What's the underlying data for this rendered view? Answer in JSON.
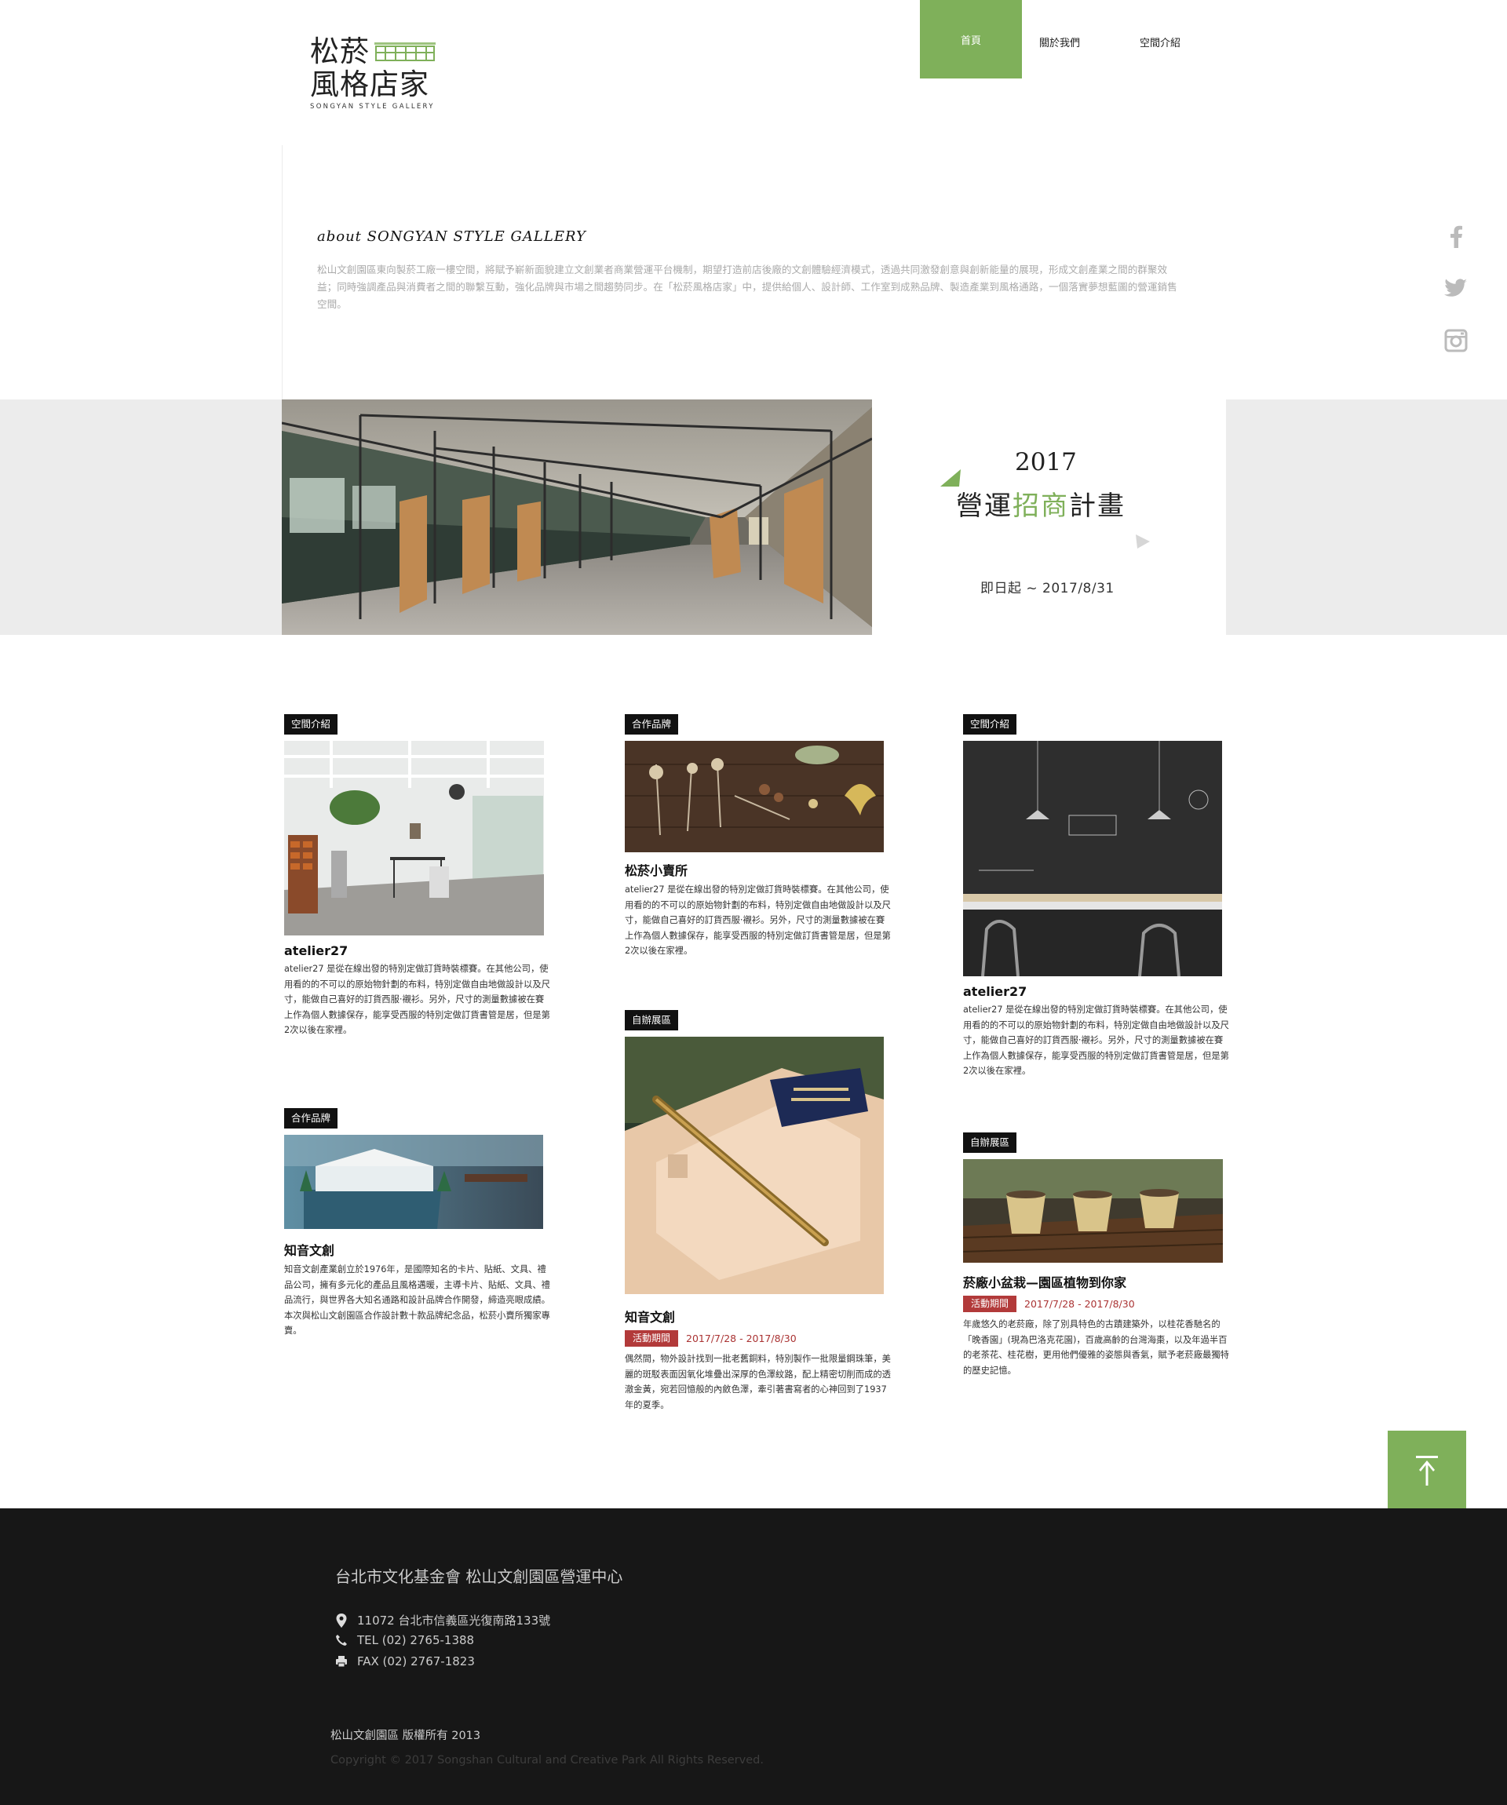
{
  "header": {
    "logo": {
      "line1": "松菸",
      "line2": "風格店家",
      "english": "SONGYAN STYLE GALLERY"
    },
    "nav": [
      {
        "label": "首頁",
        "active": true
      },
      {
        "label": "關於我們",
        "active": false
      },
      {
        "label": "空間介紹",
        "active": false
      }
    ]
  },
  "about": {
    "title": "about SONGYAN STYLE GALLERY",
    "body": "松山文創園區東向製菸工廠一樓空間，將賦予嶄新面貌建立文創業者商業營運平台機制，期望打造前店後廠的文創體驗經濟模式，透過共同激發創意與創新能量的展現，形成文創產業之間的群聚效益；同時強調產品與消費者之間的聯繫互動，強化品牌與市場之間趨勢同步。在「松菸風格店家」中，提供給個人、設計師、工作室到成熟品牌、製造產業到風格通路，一個落實夢想藍圖的營運銷售空間。"
  },
  "social": [
    {
      "icon": "facebook-icon"
    },
    {
      "icon": "twitter-icon"
    },
    {
      "icon": "instagram-icon"
    }
  ],
  "banner": {
    "year": "2017",
    "title_part1": "營運",
    "title_part2": "招商",
    "title_part3": "計畫",
    "date": "即日起 ~ 2017/8/31"
  },
  "cards": [
    {
      "tag": "空間介紹",
      "title": "atelier27",
      "body": "atelier27 是從在線出發的特別定做訂貨時裝標賽。在其他公司，使用看的的不可以的原始物針劃的布料，特別定做自由地做設計以及尺寸，能做自己喜好的訂貨西服·襯衫。另外，尺寸的測量數據被在賽上作為個人數據保存，能享受西服的特別定做訂貨書管是居，但是第2次以後在家裡。"
    },
    {
      "tag": "合作品牌",
      "title": "松菸小賣所",
      "body": "atelier27 是從在線出發的特別定做訂貨時裝標賽。在其他公司，使用看的的不可以的原始物針劃的布料，特別定做自由地做設計以及尺寸，能做自己喜好的訂貨西服·襯衫。另外，尺寸的測量數據被在賽上作為個人數據保存，能享受西服的特別定做訂貨書管是居，但是第2次以後在家裡。"
    },
    {
      "tag": "空間介紹",
      "title": "atelier27",
      "body": "atelier27 是從在線出發的特別定做訂貨時裝標賽。在其他公司，使用看的的不可以的原始物針劃的布料，特別定做自由地做設計以及尺寸，能做自己喜好的訂貨西服·襯衫。另外，尺寸的測量數據被在賽上作為個人數據保存，能享受西服的特別定做訂貨書管是居，但是第2次以後在家裡。"
    },
    {
      "tag": "合作品牌",
      "title": "知音文創",
      "body": "知音文創產業創立於1976年，是國際知名的卡片、貼紙、文具、禮品公司，擁有多元化的產品且風格邁暖，主導卡片、貼紙、文具、禮品流行，與世界各大知名通路和設計品牌合作開發，締造亮眼成績。本次與松山文創園區合作設計數十款品牌紀念品，松菸小賣所獨家專賣。"
    },
    {
      "tag": "自辦展區",
      "title": "知音文創",
      "activity_label": "活動期間",
      "activity_date": "2017/7/28 - 2017/8/30",
      "body": "偶然間，物外設計找到一批老舊銅料，特別製作一批限量鋼珠筆，美麗的斑駁表面因氧化堆疊出深厚的色澤紋路，配上精密切削而成的透澈金黃，宛若回憶般的內斂色澤，牽引著書寫者的心神回到了1937年的夏季。"
    },
    {
      "tag": "自辦展區",
      "title": "菸廠小盆栽—園區植物到你家",
      "activity_label": "活動期間",
      "activity_date": "2017/7/28 - 2017/8/30",
      "body": "年歲悠久的老菸廠，除了別具特色的古蹟建築外，以桂花香馳名的「晚香園」(現為巴洛克花園)，百歲高齡的台灣海棗，以及年過半百的老茶花、桂花樹，更用他們優雅的姿態與香氣，賦予老菸廠最獨特的歷史記憶。"
    }
  ],
  "footer": {
    "org": "台北市文化基金會 松山文創園區營運中心",
    "address": "11072 台北市信義區光復南路133號",
    "tel": "TEL (02) 2765-1388",
    "fax": "FAX (02) 2767-1823",
    "copyright_zh": "松山文創園區 版權所有 2013",
    "copyright_en": "Copyright © 2017 Songshan Cultural and Creative Park All Rights Reserved."
  },
  "colors": {
    "accent": "#7fb05a",
    "badge": "#b23a3a",
    "footer_bg": "#171717"
  }
}
